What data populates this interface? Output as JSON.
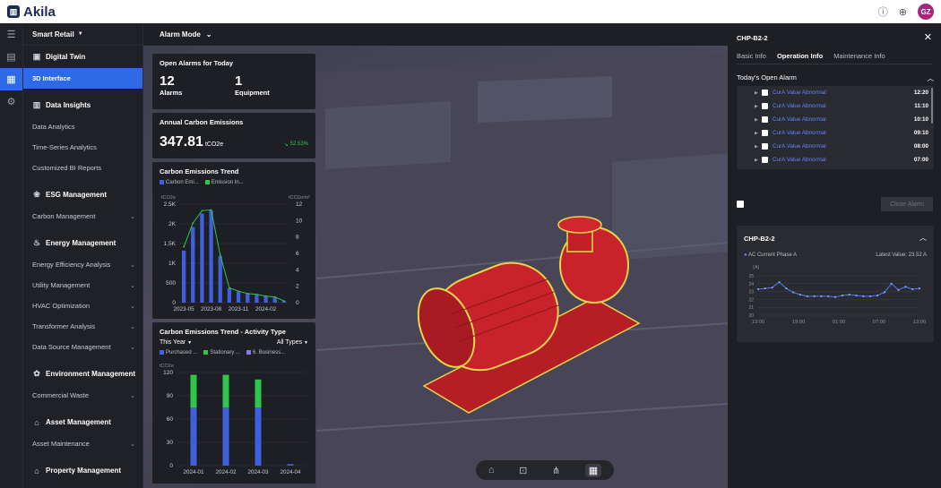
{
  "app": {
    "logo": "Akila",
    "user_initials": "GZ"
  },
  "colors": {
    "accent": "#2f6ae6",
    "bar_blue": "#3e5fe0",
    "bar_green": "#2fc64a",
    "bar_purple": "#7e7ee6",
    "equipment": "#c8222a",
    "outline": "#e6d64a",
    "link": "#5f86ff",
    "positive": "#2fc64a"
  },
  "rail": {
    "icons": [
      "menu-icon",
      "report-icon",
      "building-icon",
      "gear-icon"
    ]
  },
  "sidebar": {
    "site": "Smart Retail",
    "sections": [
      {
        "title": "Digital Twin",
        "icon": "cube-icon",
        "items": [
          {
            "label": "3D Interface",
            "active": true,
            "expand": false
          }
        ]
      },
      {
        "title": "Data Insights",
        "icon": "bar-chart-icon",
        "items": [
          {
            "label": "Data Analytics",
            "expand": false
          },
          {
            "label": "Time-Series Analytics",
            "expand": false
          },
          {
            "label": "Customized BI Reports",
            "expand": false
          }
        ]
      },
      {
        "title": "ESG Management",
        "icon": "leaf-icon",
        "items": [
          {
            "label": "Carbon Management",
            "expand": true
          }
        ]
      },
      {
        "title": "Energy Management",
        "icon": "flame-icon",
        "items": [
          {
            "label": "Energy Efficiency Analysis",
            "expand": true
          },
          {
            "label": "Utility Management",
            "expand": true
          },
          {
            "label": "HVAC Optimization",
            "expand": true
          },
          {
            "label": "Transformer Analysis",
            "expand": true
          },
          {
            "label": "Data Source Management",
            "expand": true
          }
        ]
      },
      {
        "title": "Environment Management",
        "icon": "plant-icon",
        "items": [
          {
            "label": "Commercial Waste",
            "expand": true
          }
        ]
      },
      {
        "title": "Asset Management",
        "icon": "house-icon",
        "items": [
          {
            "label": "Asset Maintenance",
            "expand": true
          }
        ]
      },
      {
        "title": "Property Management",
        "icon": "house-icon",
        "items": []
      }
    ]
  },
  "mode": {
    "label": "Alarm Mode"
  },
  "alarms_today": {
    "title": "Open Alarms for Today",
    "alarms_value": "12",
    "alarms_label": "Alarms",
    "equipment_value": "1",
    "equipment_label": "Equipment"
  },
  "emissions": {
    "title": "Annual Carbon Emissions",
    "value": "347.81",
    "unit": "tCO2e",
    "change": "52.53%"
  },
  "chart_data": [
    {
      "type": "bar",
      "title": "Carbon Emissions Trend",
      "legend": [
        "Carbon Emi...",
        "Emission In..."
      ],
      "y_unit_left": "tCO2e",
      "y_unit_right": "tCO2e/m²",
      "yticks_left": [
        "2.5K",
        "2K",
        "1.5K",
        "1K",
        "500",
        "0"
      ],
      "yticks_right": [
        "12",
        "10",
        "8",
        "6",
        "4",
        "2",
        "0"
      ],
      "xticks": [
        "2023-05",
        "2023-08",
        "2023-11",
        "2024-02"
      ],
      "ylim": [
        0,
        2500
      ],
      "ylim_right": [
        0,
        12
      ],
      "series": [
        {
          "name": "Carbon Emi...",
          "type": "bar",
          "values": [
            1320,
            1920,
            2260,
            2340,
            1180,
            370,
            280,
            230,
            200,
            170,
            140,
            40
          ]
        },
        {
          "name": "Emission In...",
          "type": "line",
          "values": [
            6.8,
            9.7,
            11.2,
            11.3,
            5.8,
            1.8,
            1.4,
            1.1,
            1.0,
            0.8,
            0.7,
            0.2
          ]
        }
      ]
    },
    {
      "type": "bar",
      "title": "Carbon Emissions Trend - Activity Type",
      "period": "This Year",
      "filter": "All Types",
      "legend": [
        "Purchased ...",
        "Stationary ...",
        "6. Business..."
      ],
      "y_unit": "tCO2e",
      "yticks": [
        "120",
        "90",
        "60",
        "30",
        "0"
      ],
      "categories": [
        "2024-01",
        "2024-02",
        "2024-03",
        "2024-04"
      ],
      "ylim": [
        0,
        120
      ],
      "series": [
        {
          "name": "Purchased ...",
          "values": [
            75,
            75,
            75,
            2
          ]
        },
        {
          "name": "Stationary ...",
          "values": [
            42,
            42,
            36,
            0
          ]
        },
        {
          "name": "6. Business...",
          "values": [
            0,
            0,
            0,
            0
          ]
        }
      ]
    },
    {
      "type": "line",
      "title": "CHP-B2-2",
      "series_label": "AC Current Phase A",
      "latest": "Latest Value: 23.52 A",
      "y_unit": "(A)",
      "yticks": [
        "25",
        "24",
        "23",
        "22",
        "21",
        "20"
      ],
      "xticks": [
        "13:00",
        "19:00",
        "01:00",
        "07:00",
        "13:00"
      ],
      "ylim": [
        20,
        25
      ],
      "series": [
        {
          "name": "AC Current Phase A",
          "values": [
            23.3,
            23.4,
            23.5,
            24.2,
            23.4,
            22.9,
            22.6,
            22.4,
            22.4,
            22.4,
            22.4,
            22.3,
            22.5,
            22.6,
            22.5,
            22.4,
            22.4,
            22.5,
            22.9,
            24.0,
            23.2,
            23.6,
            23.3,
            23.4
          ]
        }
      ]
    }
  ],
  "right_panel": {
    "title": "CHP-B2-2",
    "tabs": [
      {
        "label": "Basic Info",
        "active": false
      },
      {
        "label": "Operation Info",
        "active": true
      },
      {
        "label": "Maintenance Info",
        "active": false
      }
    ],
    "section_title": "Today's Open Alarm",
    "alarms": [
      {
        "text": "CurA Value Abnormal",
        "time": "12:20"
      },
      {
        "text": "CurA Value Abnormal",
        "time": "11:10"
      },
      {
        "text": "CurA Value Abnormal",
        "time": "10:10"
      },
      {
        "text": "CurA Value Abnormal",
        "time": "09:10"
      },
      {
        "text": "CurA Value Abnormal",
        "time": "08:00"
      },
      {
        "text": "CurA Value Abnormal",
        "time": "07:00"
      }
    ],
    "close_alarm_label": "Close Alarm"
  },
  "navbar": {
    "icons": [
      "home-icon",
      "focus-icon",
      "hierarchy-icon",
      "grid-icon"
    ]
  }
}
